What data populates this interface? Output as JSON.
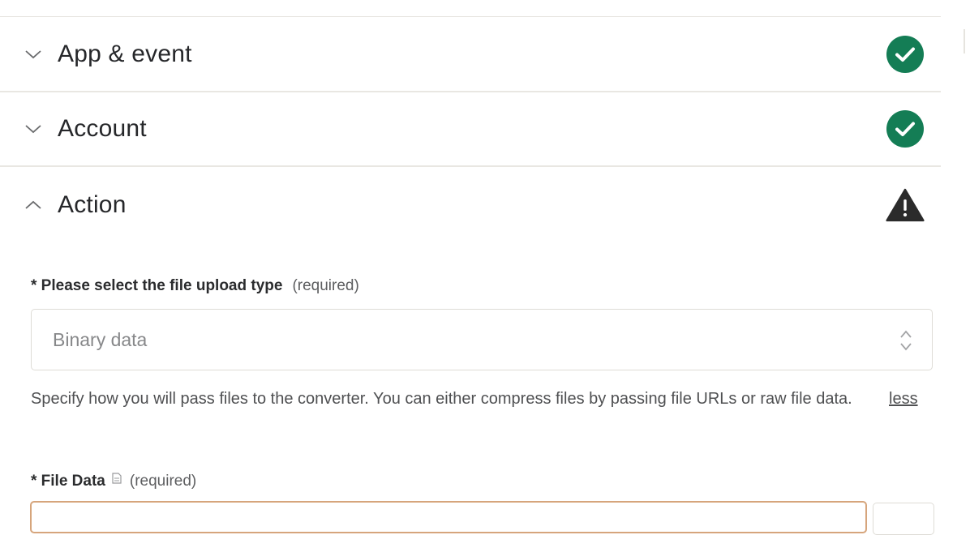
{
  "sections": [
    {
      "title": "App & event",
      "expanded": false,
      "status": "complete",
      "chevron": "chevron-down-icon",
      "status_icon": "check-circle-icon"
    },
    {
      "title": "Account",
      "expanded": false,
      "status": "complete",
      "chevron": "chevron-down-icon",
      "status_icon": "check-circle-icon"
    },
    {
      "title": "Action",
      "expanded": true,
      "status": "warning",
      "chevron": "chevron-up-icon",
      "status_icon": "warning-triangle-icon"
    }
  ],
  "upload_type": {
    "label": "* Please select the file upload type",
    "required_text": "(required)",
    "value": "Binary data",
    "help": "Specify how you will pass files to the converter. You can either compress files by passing file URLs or raw file data.",
    "less_link": "less"
  },
  "file_data": {
    "label": "* File Data",
    "required_text": "(required)",
    "icon": "file-icon"
  },
  "colors": {
    "success": "#147d55",
    "warning": "#2b2b2b",
    "input_border_error": "#d6a57c"
  }
}
